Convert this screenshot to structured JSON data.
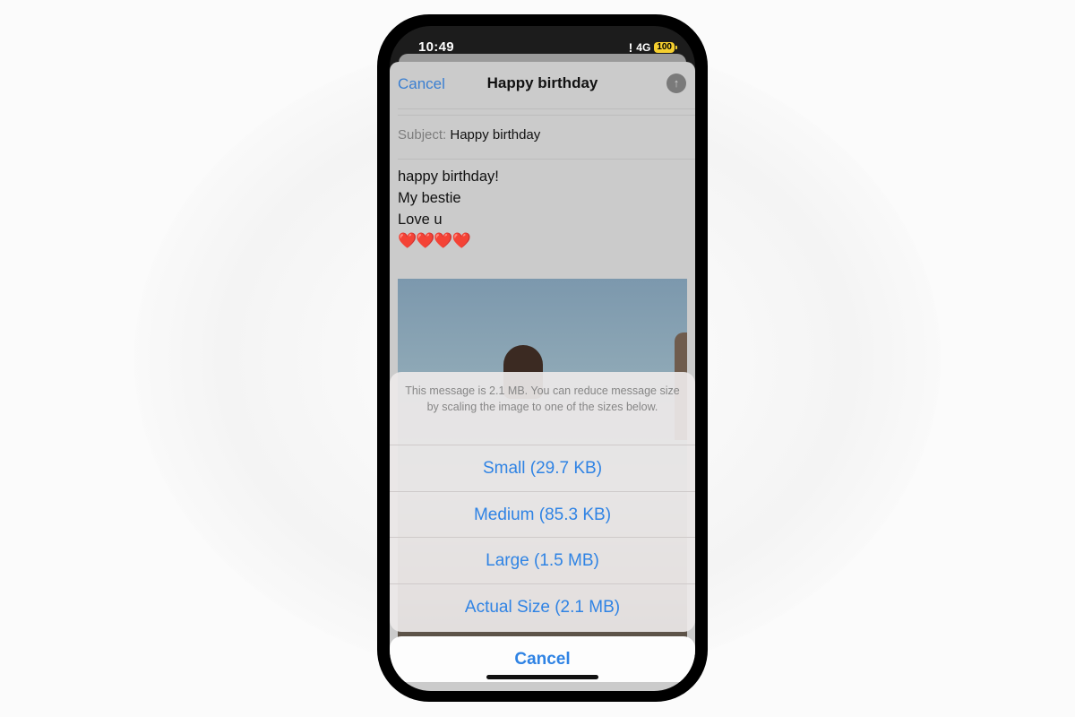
{
  "status_bar": {
    "time": "10:49",
    "alert": "!",
    "network": "4G",
    "battery": "100"
  },
  "compose": {
    "cancel_label": "Cancel",
    "title": "Happy birthday",
    "send_icon": "arrow-up-icon",
    "subject_label": "Subject:",
    "subject_value": "Happy birthday",
    "body_lines": [
      "happy birthday!",
      "My bestie",
      "Love u"
    ],
    "hearts": "❤️❤️❤️❤️"
  },
  "action_sheet": {
    "message": "This message is 2.1 MB. You can reduce message size by scaling the image to one of the sizes below.",
    "options": [
      {
        "label": "Small (29.7 KB)"
      },
      {
        "label": "Medium (85.3 KB)"
      },
      {
        "label": "Large (1.5 MB)"
      },
      {
        "label": "Actual Size (2.1 MB)"
      }
    ],
    "cancel_label": "Cancel"
  },
  "colors": {
    "accent": "#2f83e4",
    "battery": "#f5cf2e"
  }
}
